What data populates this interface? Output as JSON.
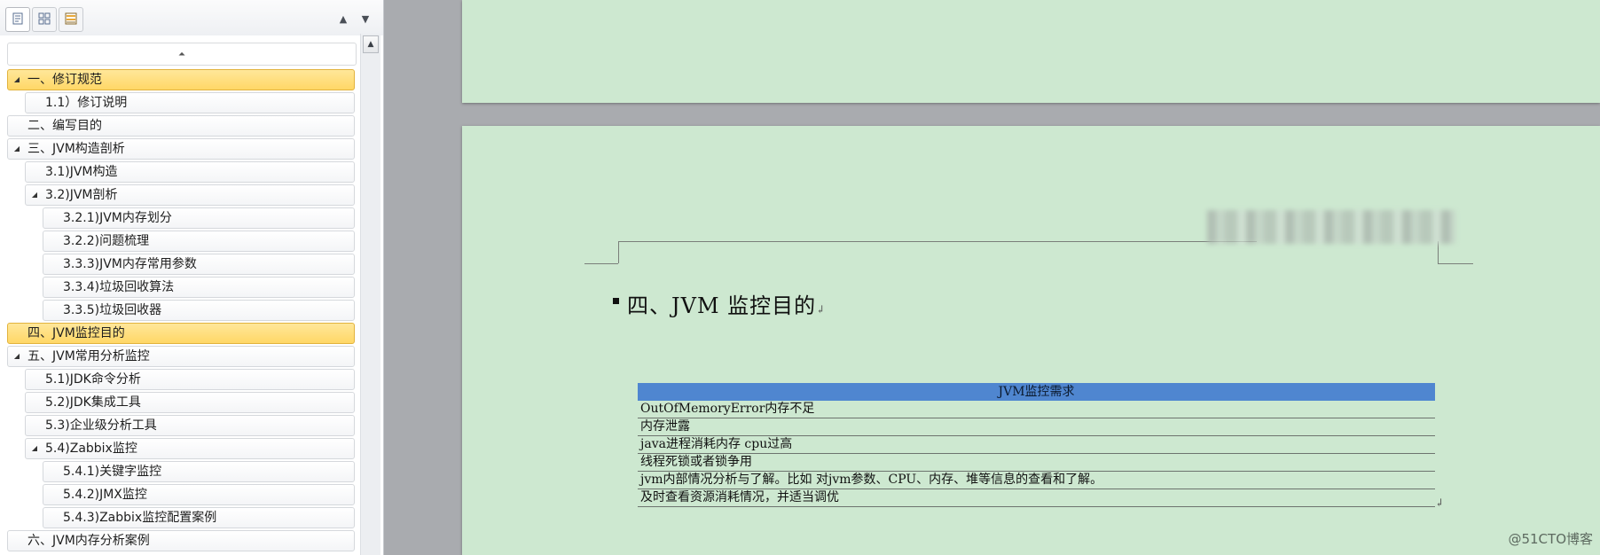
{
  "nav": {
    "toolbar": {
      "headings_view_icon": "document-icon",
      "pages_view_icon": "thumbnails-icon",
      "results_view_icon": "results-icon",
      "prev_icon": "triangle-up-icon",
      "next_icon": "triangle-down-icon"
    },
    "collapse_all_icon": "collapse-up-icon",
    "items": [
      {
        "label": "一、修订规范",
        "level": 0,
        "expanded": true,
        "selected": true
      },
      {
        "label": "1.1）修订说明",
        "level": 1,
        "expanded": false,
        "selected": false
      },
      {
        "label": "二、编写目的",
        "level": 0,
        "expanded": false,
        "selected": false
      },
      {
        "label": "三、JVM构造剖析",
        "level": 0,
        "expanded": true,
        "selected": false
      },
      {
        "label": "3.1)JVM构造",
        "level": 1,
        "expanded": false,
        "selected": false
      },
      {
        "label": "3.2)JVM剖析",
        "level": 1,
        "expanded": true,
        "selected": false
      },
      {
        "label": "3.2.1)JVM内存划分",
        "level": 2,
        "expanded": false,
        "selected": false
      },
      {
        "label": "3.2.2)问题梳理",
        "level": 2,
        "expanded": false,
        "selected": false
      },
      {
        "label": "3.3.3)JVM内存常用参数",
        "level": 2,
        "expanded": false,
        "selected": false
      },
      {
        "label": "3.3.4)垃圾回收算法",
        "level": 2,
        "expanded": false,
        "selected": false
      },
      {
        "label": "3.3.5)垃圾回收器",
        "level": 2,
        "expanded": false,
        "selected": false
      },
      {
        "label": "四、JVM监控目的",
        "level": 0,
        "expanded": false,
        "selected": true
      },
      {
        "label": "五、JVM常用分析监控",
        "level": 0,
        "expanded": true,
        "selected": false
      },
      {
        "label": "5.1)JDK命令分析",
        "level": 1,
        "expanded": false,
        "selected": false
      },
      {
        "label": "5.2)JDK集成工具",
        "level": 1,
        "expanded": false,
        "selected": false
      },
      {
        "label": "5.3)企业级分析工具",
        "level": 1,
        "expanded": false,
        "selected": false
      },
      {
        "label": "5.4)Zabbix监控",
        "level": 1,
        "expanded": true,
        "selected": false
      },
      {
        "label": "5.4.1)关键字监控",
        "level": 2,
        "expanded": false,
        "selected": false
      },
      {
        "label": "5.4.2)JMX监控",
        "level": 2,
        "expanded": false,
        "selected": false
      },
      {
        "label": "5.4.3)Zabbix监控配置案例",
        "level": 2,
        "expanded": false,
        "selected": false
      },
      {
        "label": "六、JVM内存分析案例",
        "level": 0,
        "expanded": false,
        "selected": false
      }
    ]
  },
  "document": {
    "heading": "四、JVM 监控目的",
    "paragraph_mark": "↲",
    "table": {
      "header": "JVM监控需求",
      "rows": [
        "OutOfMemoryError内存不足",
        "内存泄露",
        "java进程消耗内存 cpu过高",
        "线程死锁或者锁争用",
        "jvm内部情况分析与了解。比如 对jvm参数、CPU、内存、堆等信息的查看和了解。",
        "及时查看资源消耗情况，并适当调优"
      ]
    },
    "colors": {
      "page_background": "#cde8d0",
      "table_header": "#4f86d0",
      "selection": "#ffd766"
    }
  },
  "watermark": "@51CTO博客"
}
